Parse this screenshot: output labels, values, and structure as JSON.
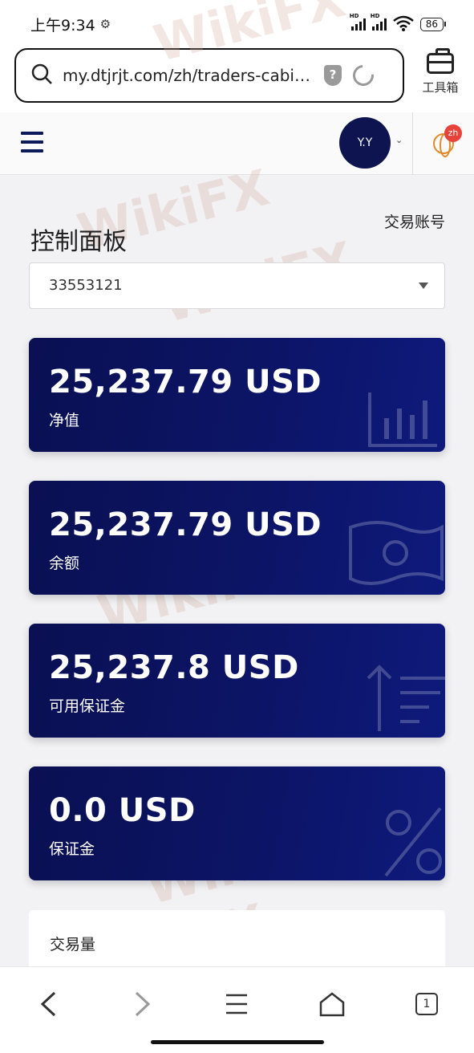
{
  "status_bar": {
    "time": "上午9:34",
    "network_label": "HD",
    "battery": "86"
  },
  "browser": {
    "url": "my.dtjrjt.com/zh/traders-cabi…",
    "shield_glyph": "?",
    "toolbox_label": "工具箱"
  },
  "site_header": {
    "avatar_initials": "Y.Y",
    "lang_badge": "zh"
  },
  "dashboard": {
    "title": "控制面板",
    "trade_accounts_link": "交易账号",
    "selected_account": "33553121",
    "cards": [
      {
        "value": "25,237.79 USD",
        "label": "净值",
        "icon": "bar-chart-icon"
      },
      {
        "value": "25,237.79 USD",
        "label": "余额",
        "icon": "banknote-icon"
      },
      {
        "value": "25,237.8 USD",
        "label": "可用保证金",
        "icon": "sort-arrow-icon"
      },
      {
        "value": "0.0 USD",
        "label": "保证金",
        "icon": "percent-icon"
      }
    ],
    "volume_label": "交易量"
  },
  "watermark_text": "WikiFX",
  "bottom_nav": {
    "tab_count": "1"
  },
  "colors": {
    "card_bg": "#0c1466",
    "avatar_bg": "#0d1450",
    "badge": "#e8433a"
  }
}
